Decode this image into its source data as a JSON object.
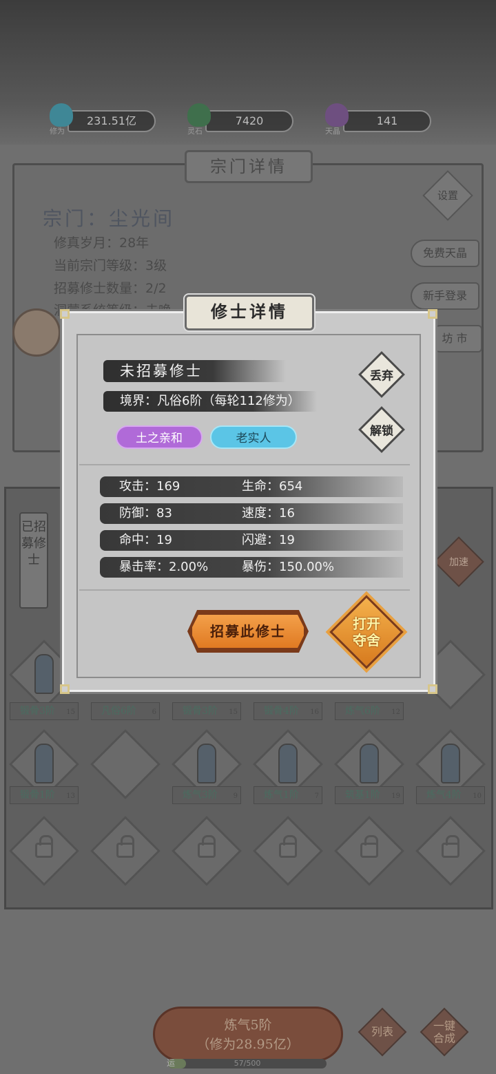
{
  "resources": [
    {
      "icon": "cultivation-flame-icon",
      "label": "修为",
      "value": "231.51亿",
      "color": "#4aa0b0"
    },
    {
      "icon": "spirit-stone-icon",
      "label": "灵石",
      "value": "7420",
      "color": "#4c8a5c"
    },
    {
      "icon": "sky-crystal-icon",
      "label": "天晶",
      "value": "141",
      "color": "#8a5aa0"
    }
  ],
  "sect": {
    "panel_title": "宗门详情",
    "name": "宗门：尘光间",
    "years": "修真岁月：28年",
    "level": "当前宗门等级：3级",
    "recruit_count": "招募修士数量：2/2",
    "system_level": "洞蒙系统等级：未唤"
  },
  "side_buttons": {
    "settings": "设置",
    "free_crystal": "免费天晶",
    "newbie_login": "新手登录",
    "market": "坊 市"
  },
  "recruited_tab": "已招募修士",
  "accelerate": "加速",
  "grid_slots": [
    {
      "label": "锻骨3阶",
      "num": "15"
    },
    {
      "label": "凡俗6阶",
      "num": "6"
    },
    {
      "label": "锻骨3阶",
      "num": "15"
    },
    {
      "label": "锻骨4阶",
      "num": "16"
    },
    {
      "label": "炼气6阶",
      "num": "12"
    },
    {
      "label": "锻骨1阶",
      "num": "13"
    },
    {
      "label": "炼气3阶",
      "num": "9"
    },
    {
      "label": "炼气1阶",
      "num": "7"
    },
    {
      "label": "筑基1阶",
      "num": "19"
    },
    {
      "label": "炼气4阶",
      "num": "10"
    }
  ],
  "bottom": {
    "main_line1": "炼气5阶",
    "main_line2": "（修为28.95亿）",
    "progress_text": "57/500",
    "progress_fraction": 0.114,
    "progress_prefix": "运",
    "list_button": "列表",
    "merge_button_line1": "一键",
    "merge_button_line2": "合成"
  },
  "modal": {
    "title": "修士详情",
    "cultivator_name": "未招募修士",
    "realm": "境界：凡俗6阶（每轮112修为）",
    "tags": [
      {
        "label": "土之亲和",
        "color": "#b56adf"
      },
      {
        "label": "老实人",
        "color": "#5ec7e8"
      }
    ],
    "discard_button": "丢弃",
    "unlock_button": "解锁",
    "stats": [
      {
        "left": "攻击：169",
        "right": "生命：654"
      },
      {
        "left": "防御：83",
        "right": "速度：16"
      },
      {
        "left": "命中：19",
        "right": "闪避：19"
      },
      {
        "left": "暴击率：2.00%",
        "right": "暴伤：150.00%"
      }
    ],
    "recruit_button": "招募此修士",
    "seize_line1": "打开",
    "seize_line2": "夺舍"
  }
}
